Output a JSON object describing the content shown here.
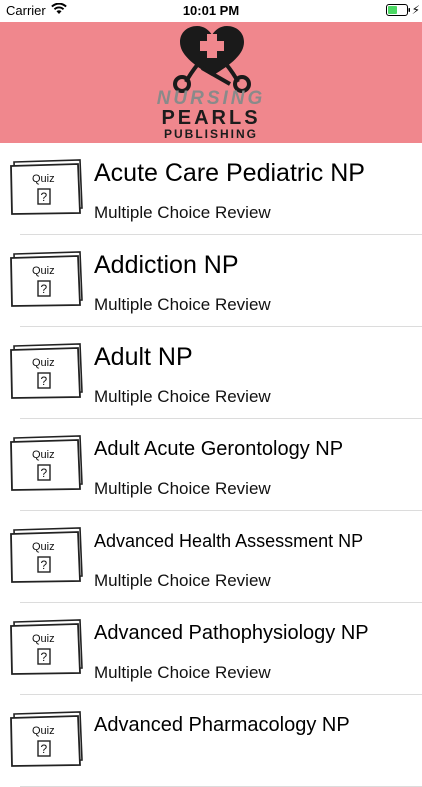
{
  "status_bar": {
    "carrier": "Carrier",
    "time": "10:01 PM"
  },
  "header": {
    "logo_line1": "NURSING",
    "logo_line2": "PEARLS",
    "logo_line3": "PUBLISHING",
    "background": "#f0878d"
  },
  "quiz_icon": {
    "label": "Quiz",
    "glyph": "?"
  },
  "items": [
    {
      "title": "Acute Care Pediatric NP",
      "subtitle": "Multiple Choice Review"
    },
    {
      "title": "Addiction NP",
      "subtitle": "Multiple Choice Review"
    },
    {
      "title": "Adult NP",
      "subtitle": "Multiple Choice Review"
    },
    {
      "title": "Adult Acute Gerontology NP",
      "subtitle": "Multiple Choice Review"
    },
    {
      "title": "Advanced Health Assessment NP",
      "subtitle": "Multiple Choice Review"
    },
    {
      "title": "Advanced Pathophysiology NP",
      "subtitle": "Multiple Choice Review"
    },
    {
      "title": "Advanced Pharmacology NP",
      "subtitle": ""
    }
  ]
}
